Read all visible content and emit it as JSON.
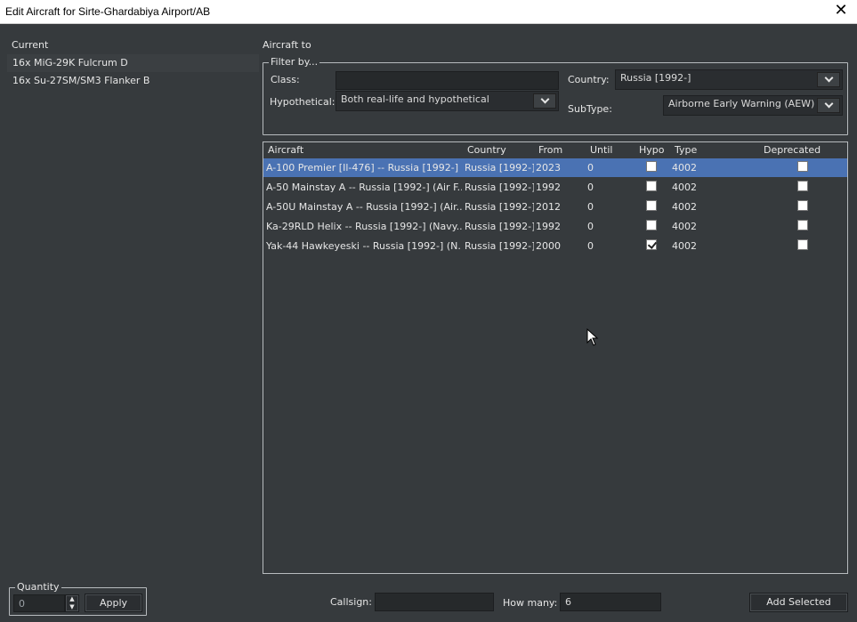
{
  "window": {
    "title": "Edit Aircraft for Sirte-Ghardabiya Airport/AB",
    "close_icon": "close-icon"
  },
  "current": {
    "label": "Current",
    "items": [
      "16x MiG-29K Fulcrum D",
      "16x Su-27SM/SM3 Flanker B"
    ]
  },
  "aircraft_to": {
    "label": "Aircraft to"
  },
  "filter": {
    "legend": "Filter by...",
    "class_label": "Class:",
    "class_value": "",
    "country_label": "Country:",
    "country_value": "Russia [1992-]",
    "hypothetical_label": "Hypothetical:",
    "hypothetical_value": "Both real-life and hypothetical",
    "subtype_label": "SubType:",
    "subtype_value": "Airborne Early Warning (AEW)"
  },
  "table": {
    "columns": [
      "Aircraft",
      "Country",
      "From",
      "Until",
      "Hypo",
      "Type",
      "Deprecated"
    ],
    "rows": [
      {
        "aircraft": "A-100 Premier [Il-476] -- Russia [1992-] ...",
        "country": "Russia [1992-]",
        "from": "2023",
        "until": "0",
        "hypo": false,
        "type": "4002",
        "deprecated": false,
        "selected": true
      },
      {
        "aircraft": "A-50 Mainstay A -- Russia [1992-] (Air F...",
        "country": "Russia [1992-]",
        "from": "1992",
        "until": "0",
        "hypo": false,
        "type": "4002",
        "deprecated": false,
        "selected": false
      },
      {
        "aircraft": "A-50U Mainstay A -- Russia [1992-] (Air...",
        "country": "Russia [1992-]",
        "from": "2012",
        "until": "0",
        "hypo": false,
        "type": "4002",
        "deprecated": false,
        "selected": false
      },
      {
        "aircraft": "Ka-29RLD Helix -- Russia [1992-] (Navy...",
        "country": "Russia [1992-]",
        "from": "1992",
        "until": "0",
        "hypo": false,
        "type": "4002",
        "deprecated": false,
        "selected": false
      },
      {
        "aircraft": "Yak-44 Hawkeyeski -- Russia [1992-] (N...",
        "country": "Russia [1992-]",
        "from": "2000",
        "until": "0",
        "hypo": true,
        "type": "4002",
        "deprecated": false,
        "selected": false
      }
    ]
  },
  "quantity": {
    "legend": "Quantity",
    "value": "0",
    "apply_label": "Apply"
  },
  "bottom": {
    "callsign_label": "Callsign:",
    "callsign_value": "",
    "how_many_label": "How many:",
    "how_many_value": "6",
    "add_selected_label": "Add Selected"
  }
}
